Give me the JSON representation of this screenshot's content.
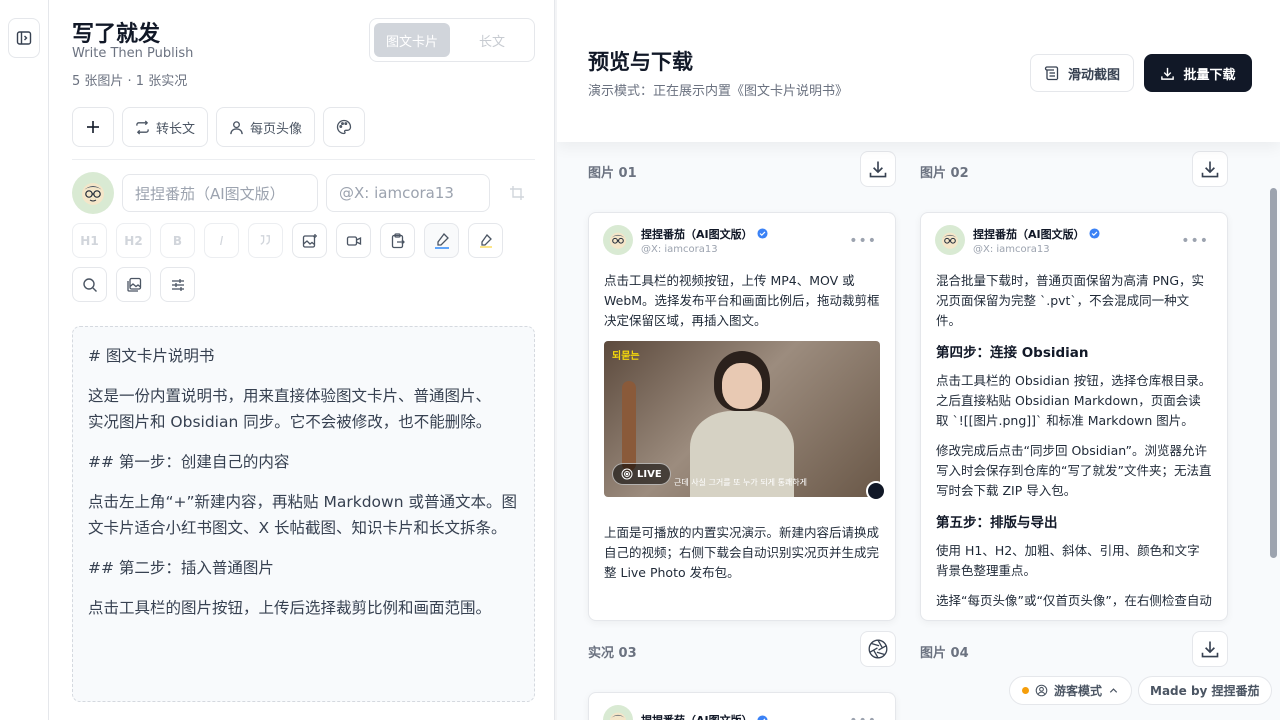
{
  "app": {
    "title": "写了就发",
    "subtitle": "Write Then Publish",
    "count": "5 张图片 · 1 张实况",
    "modes": [
      "图文卡片",
      "长文"
    ]
  },
  "toolbar": {
    "convert_label": "转长文",
    "avatar_label": "每页头像"
  },
  "author": {
    "name_placeholder": "捏捏番茄（AI图文版）",
    "handle_placeholder": "@X: iamcora13"
  },
  "format": {
    "h1": "H1",
    "h2": "H2",
    "bold": "B",
    "italic": "I"
  },
  "editor_lines": [
    "# 图文卡片说明书",
    "",
    "这是一份内置说明书，用来直接体验图文卡片、普通图片、",
    "实况图片和 Obsidian 同步。它不会被修改，也不能删除。",
    "",
    "## 第一步：创建自己的内容",
    "",
    "点击左上角“+”新建内容，再粘贴 Markdown 或普通文本。图",
    "文卡片适合小红书图文、X 长帖截图、知识卡片和长文拆条。",
    "",
    "## 第二步：插入普通图片",
    "",
    "点击工具栏的图片按钮，上传后选择裁剪比例和画面范围。"
  ],
  "preview": {
    "title": "预览与下载",
    "subtitle": "演示模式：正在展示内置《图文卡片说明书》",
    "scroll_capture_label": "滑动截图",
    "batch_download_label": "批量下载"
  },
  "cards": [
    {
      "label": "图片 01",
      "name": "捏捏番茄（AI图文版）",
      "handle": "@X: iamcora13",
      "p1": "点击工具栏的视频按钮，上传 MP4、MOV 或 WebM。选择发布平台和画面比例后，拖动裁剪框决定保留区域，再插入图文。",
      "live_label": "LIVE",
      "video_logo": "되묻는",
      "video_caption": "근데 사실 그거를 또 누가 되게 통쾌하게",
      "p2": "上面是可播放的内置实况演示。新建内容后请换成自己的视频；右侧下载会自动识别实况页并生成完整 Live Photo 发布包。"
    },
    {
      "label": "图片 02",
      "name": "捏捏番茄（AI图文版）",
      "handle": "@X: iamcora13",
      "p1": "混合批量下载时，普通页面保留为高清 PNG，实况页面保留为完整 `.pvt`，不会混成同一种文件。",
      "h1": "第四步：连接 Obsidian",
      "p2": "点击工具栏的 Obsidian 按钮，选择仓库根目录。之后直接粘贴 Obsidian Markdown，页面会读取 `![[图片.png]]` 和标准 Markdown 图片。",
      "p3": "修改完成后点击“同步回 Obsidian”。浏览器允许写入时会保存到仓库的“写了就发”文件夹；无法直写时会下载 ZIP 导入包。",
      "h2": "第五步：排版与导出",
      "p4": "使用 H1、H2、加粗、斜体、引用、颜色和文字背景色整理重点。",
      "p5": "选择“每页头像”或“仅首页头像”，在右侧检查自动"
    },
    {
      "label": "实况 03",
      "name": "捏捏番茄（AI图文版）"
    },
    {
      "label": "图片 04"
    }
  ],
  "footer": {
    "guest_label": "游客模式",
    "made_by": "Made by 捏捏番茄"
  },
  "colors": {
    "primary_dark": "#111827",
    "verified": "#3b82f6",
    "guest_dot": "#f59e0b"
  }
}
